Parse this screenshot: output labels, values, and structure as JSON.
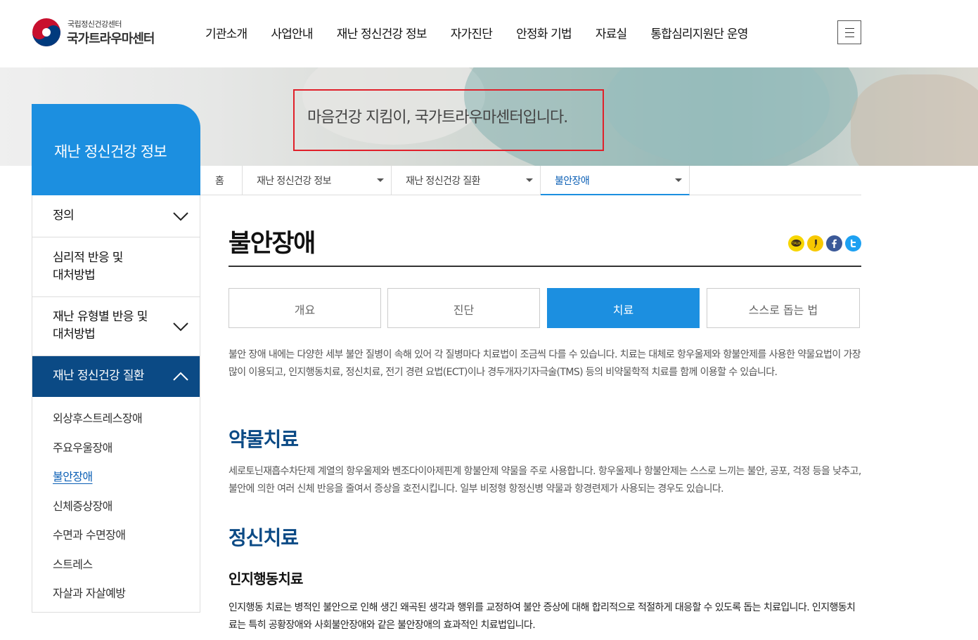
{
  "header": {
    "logo_sub": "국립정신건강센터",
    "logo_main": "국가트라우마센터",
    "nav": [
      "기관소개",
      "사업안내",
      "재난 정신건강 정보",
      "자가진단",
      "안정화 기법",
      "자료실",
      "통합심리지원단 운영"
    ]
  },
  "banner": {
    "tagline": "마음건강 지킴이, 국가트라우마센터입니다."
  },
  "sidebar": {
    "title": "재난 정신건강 정보",
    "items": [
      {
        "label": "정의"
      },
      {
        "label": "심리적 반응 및\n대처방법"
      },
      {
        "label": "재난 유형별 반응 및\n대처방법"
      },
      {
        "label": "재난 정신건강 질환"
      }
    ],
    "sub_items": [
      "외상후스트레스장애",
      "주요우울장애",
      "불안장애",
      "신체증상장애",
      "수면과 수면장애",
      "스트레스",
      "자살과 자살예방"
    ]
  },
  "breadcrumb": [
    "홈",
    "재난 정신건강 정보",
    "재난 정신건강 질환",
    "불안장애"
  ],
  "page": {
    "title": "불안장애",
    "tabs": [
      "개요",
      "진단",
      "치료",
      "스스로 돕는 법"
    ],
    "intro": "불안 장애 내에는 다양한 세부 불안 질병이 속해 있어 각 질병마다 치료법이 조금씩 다를 수 있습니다. 치료는 대체로 항우울제와 항불안제를 사용한 약물요법이 가장 많이 이용되고, 인지행동치료, 정신치료, 전기 경련 요법(ECT)이나 경두개자기자극술(TMS) 등의 비약물학적 치료를 함께 이용할 수 있습니다.",
    "sections": [
      {
        "heading": "약물치료",
        "text": "세로토닌재흡수차단제 계열의 항우울제와 벤조다이아제핀계 항불안제 약물을 주로 사용합니다. 항우울제나 항불안제는 스스로 느끼는 불안, 공포, 걱정 등을 낮추고, 불안에 의한 여러 신체 반응을 줄여서 증상을 호전시킵니다. 일부 비정형 항정신병 약물과 항경련제가 사용되는 경우도 있습니다."
      },
      {
        "heading": "정신치료",
        "subheading": "인지행동치료",
        "text": "인지행동 치료는 병적인 불안으로 인해 생긴 왜곡된 생각과 행위를 교정하여 불안 증상에 대해 합리적으로 적절하게 대응할 수 있도록 돕는 치료입니다. 인지행동치료는 특히 공황장애와 사회불안장애와 같은 불안장애의 효과적인 치료법입니다."
      }
    ]
  },
  "share_icons": [
    "kakaotalk-icon",
    "kakaostory-icon",
    "facebook-icon",
    "twitter-icon"
  ],
  "colors": {
    "primary": "#1c8fe0",
    "navy": "#0b4a85",
    "highlight_box": "#e0202a"
  }
}
